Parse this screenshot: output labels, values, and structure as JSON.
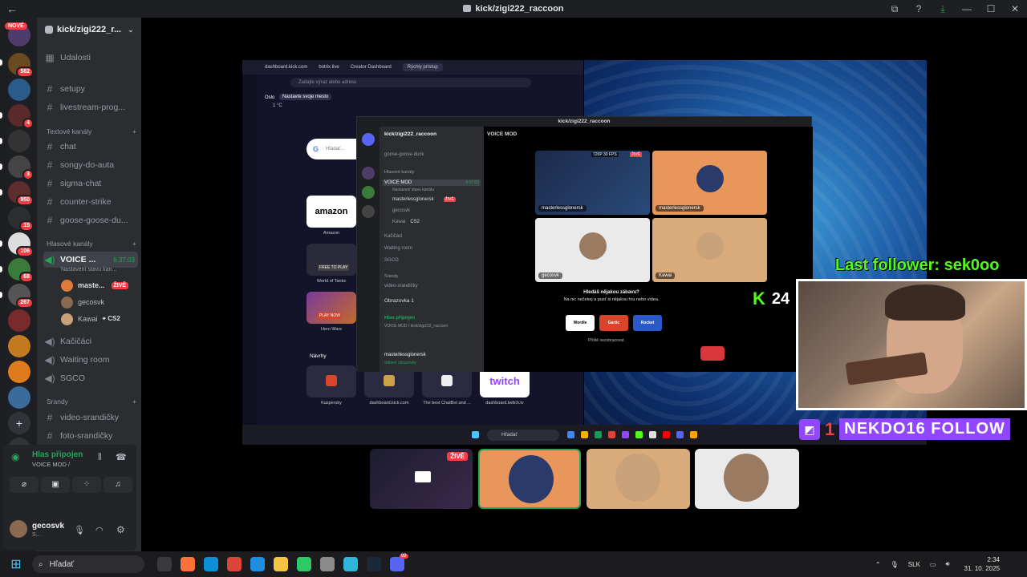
{
  "window": {
    "back_icon": "arrow-left-icon",
    "title": "kick/zigi222_raccoon",
    "nove_badge": "NOVÉ"
  },
  "rail": {
    "servers": [
      {
        "name": "server-1",
        "badge": "",
        "color": "#4e3d6b"
      },
      {
        "name": "server-2",
        "badge": "582",
        "color": "#6a4a1f"
      },
      {
        "name": "server-3",
        "badge": "",
        "color": "#2a5c8a"
      },
      {
        "name": "server-4",
        "badge": "4",
        "color": "#5a2a2a"
      },
      {
        "name": "server-5",
        "badge": "",
        "color": "#333"
      },
      {
        "name": "server-6",
        "badge": "3",
        "color": "#444"
      },
      {
        "name": "server-7",
        "badge": "950",
        "color": "#5e2e2e"
      },
      {
        "name": "server-8",
        "badge": "15",
        "color": "#2b2d31"
      },
      {
        "name": "server-9",
        "badge": "106",
        "color": "#ddd"
      },
      {
        "name": "server-10",
        "badge": "68",
        "color": "#3a7a3a"
      },
      {
        "name": "server-11",
        "badge": "267",
        "color": "#555"
      },
      {
        "name": "server-12",
        "badge": "",
        "color": "#7a2a2a"
      },
      {
        "name": "server-13",
        "badge": "",
        "color": "#c47a1f"
      },
      {
        "name": "server-14",
        "badge": "",
        "color": "#e07a1f"
      },
      {
        "name": "server-15",
        "badge": "",
        "color": "#3a6a9a"
      }
    ]
  },
  "sidebar": {
    "server_name": "kick/zigi222_r...",
    "events_label": "Udalosti",
    "channels_top": [
      "setupy",
      "livestream-prog..."
    ],
    "text_category": "Textové kanály",
    "text_channels": [
      "chat",
      "songy-do-auta",
      "sigma-chat",
      "counter-strike",
      "goose-goose-du..."
    ],
    "voice_category": "Hlasové kanály",
    "active_voice": {
      "name": "VOICE ...",
      "time": "6:37:03",
      "status": "Nastavení stavu kan..."
    },
    "voice_users": [
      {
        "name": "maste...",
        "tag": "ŽIVĚ",
        "color": "#e07a3a"
      },
      {
        "name": "gecosvk",
        "tag": "",
        "color": "#8a6a50"
      },
      {
        "name": "Kawai",
        "tag": "CS2",
        "color": "#c9a27a"
      }
    ],
    "voice_channels": [
      "Kačičáci",
      "Waiting room",
      "SGCO"
    ],
    "srandy_category": "Srandy",
    "srandy_channels": [
      "video-srandičky",
      "foto-srandičky"
    ]
  },
  "voice_panel": {
    "status": "Hlas připojen",
    "channel": "VOICE MOD / ",
    "user_name": "gecosvk",
    "user_status": "S..."
  },
  "stream": {
    "browser_tabs": [
      "dashboard.kick.com",
      "botrix.live",
      "Creator Dashboard",
      "Rýchly prístup"
    ],
    "address_placeholder": "Zadajte výraz alebo adresu",
    "weather_city": "Oslo",
    "weather_button": "Nastavte svoje mesto",
    "weather_temp": "1 °C",
    "google_placeholder": "Hľadať...",
    "tiles": [
      {
        "label": "Amazon",
        "text": "amazon"
      },
      {
        "label": "World of Tanks",
        "text": "FREE TO PLAY"
      },
      {
        "label": "Hero Wars",
        "text": "PLAY NOW"
      }
    ],
    "suggestions_label": "Návrhy",
    "bottom_tiles": [
      "Kaspersky",
      "dashboard.kick.com",
      "The best ChatBot and ...",
      "dashboard.twitch.tv"
    ],
    "twitch_logo": "twitch",
    "taskbar_search": "Hľadať",
    "inner_discord": {
      "title": "kick/zigi222_raccoon",
      "server": "kick/zigi222_raccoon",
      "channel_header": "VOICE MOD",
      "rows": [
        "goose-goose-duck",
        "Hlasové kanály",
        "VOICE MOD",
        "Nastavení stavu kanálu",
        "masterlessglonersk",
        "gecosvk",
        "Kawai",
        "Kačičáci",
        "Waiting room",
        "SGCO",
        "Srandy",
        "video-srandičky"
      ],
      "live_tag": "ŽIVĚ",
      "cs2_tag": "CS2",
      "time": "6:37:03",
      "screen_label": "Obrazovka 1",
      "voice_status": "Hlas připojen",
      "voice_channel": "VOICE MOD / kick/zigi222_raccoon",
      "user_name": "masterlessglonersk",
      "user_sub": "Sdílení obrazovky",
      "tiles": [
        {
          "name": "masterlessglonersk",
          "tag": "720P 30 FPS",
          "live": "ŽIVĚ"
        },
        {
          "name": "masterlessglonersk"
        },
        {
          "name": "gecosvk"
        },
        {
          "name": "Kawai"
        }
      ],
      "activity_prompt": "Hledáš nějakou zábavu?",
      "activity_sub": "Na nic nečekej a pusť si nějakou hru nebo videa.",
      "activity_games": [
        "Wordle",
        "Gartic",
        "Rocket"
      ],
      "activity_checkbox": "Příště nezobrazovat."
    }
  },
  "overlay": {
    "last_follower": "Last follower: sek0oo",
    "kick_count": "24",
    "kick_logo": "K",
    "twitch_count": "1",
    "follow_name": "NEKDO16 FOLLOW"
  },
  "bottom_tiles": {
    "first_live": "ŽIVĚ"
  },
  "taskbar": {
    "search_label": "Hľadať",
    "lang": "SLK",
    "time": "2:34",
    "date": "31. 10. 2025",
    "discord_badge": "99"
  }
}
